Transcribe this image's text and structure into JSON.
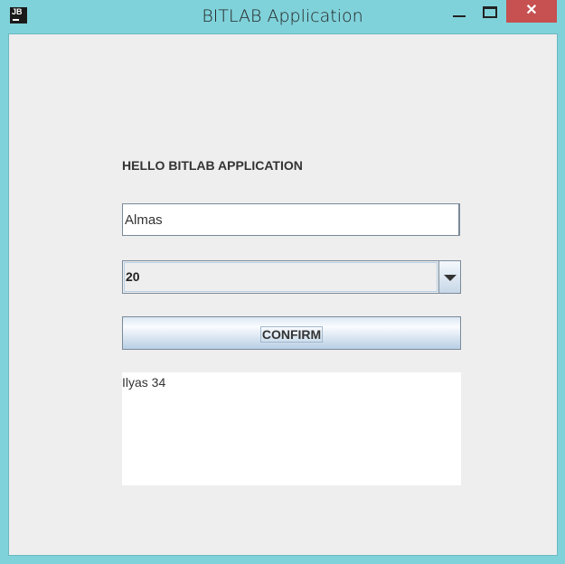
{
  "window": {
    "title": "BITLAB Application",
    "icon": "JB",
    "close_glyph": "✕"
  },
  "form": {
    "heading": "HELLO BITLAB APPLICATION",
    "name_value": "Almas",
    "age_selected": "20",
    "confirm_label": "CONFIRM",
    "output_text": "Ilyas 34"
  }
}
